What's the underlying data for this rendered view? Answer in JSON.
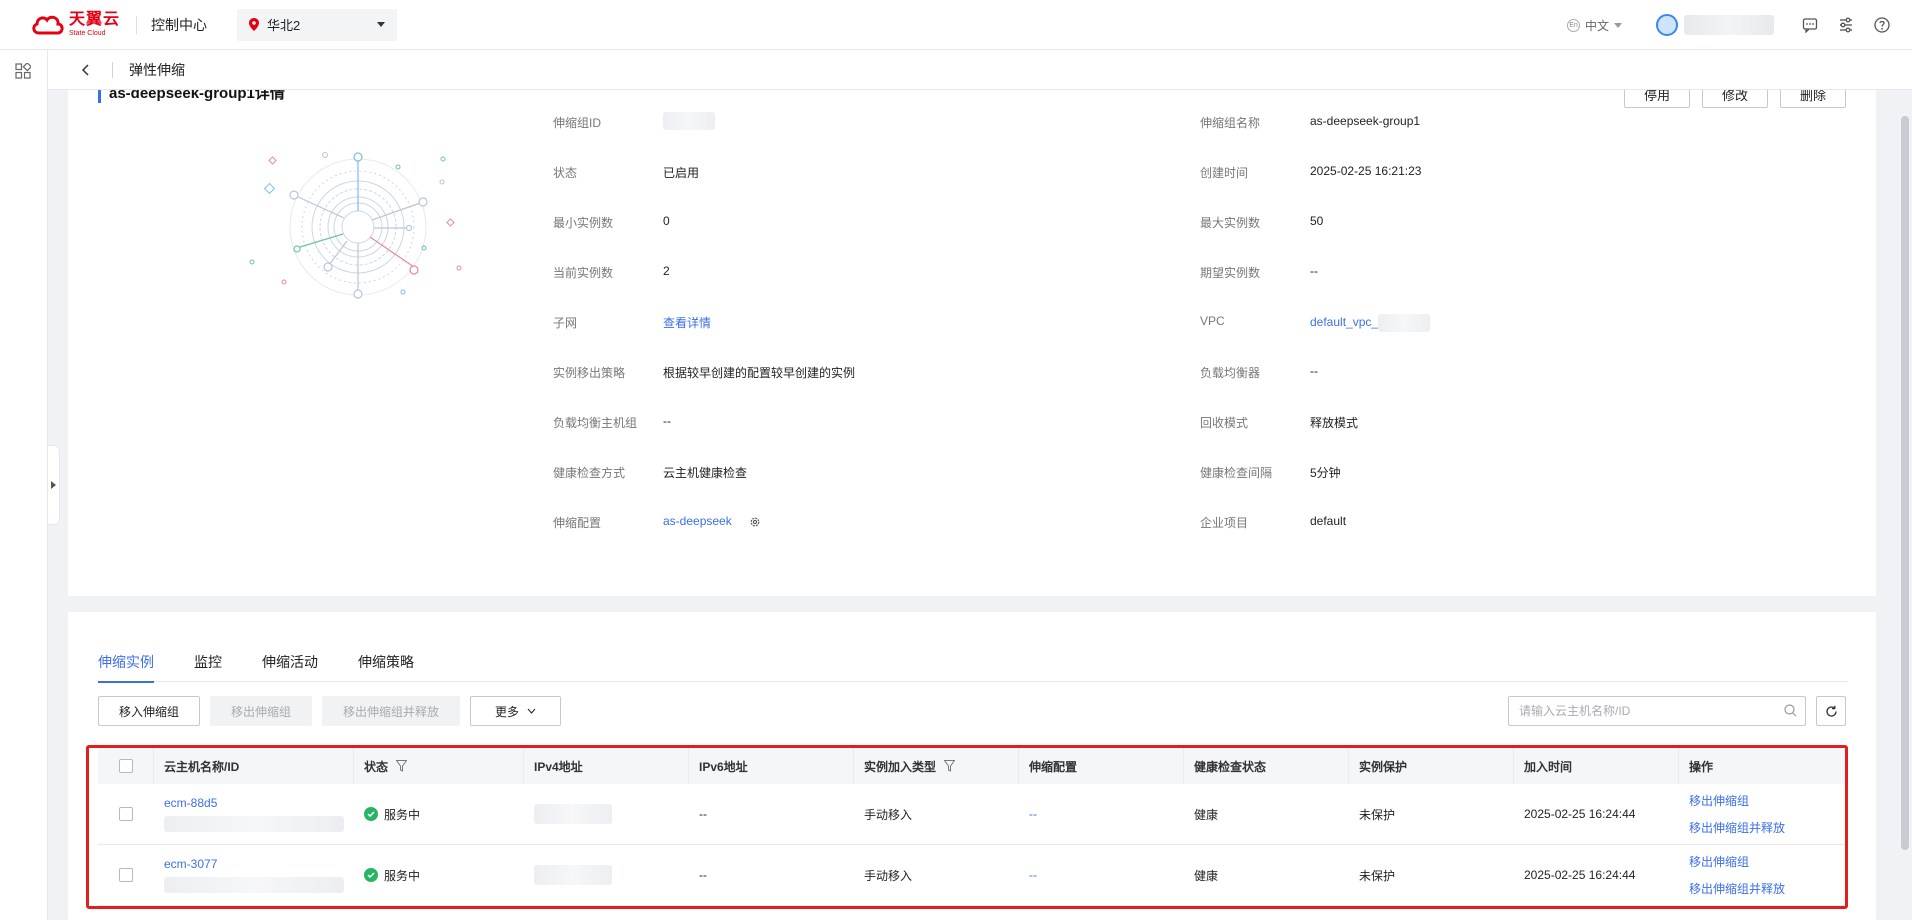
{
  "topbar": {
    "logo_cn": "天翼云",
    "logo_en": "State Cloud",
    "console_title": "控制中心",
    "region": "华北2",
    "language": "中文",
    "lang_badge": "En"
  },
  "breadcrumb": {
    "title": "弹性伸缩"
  },
  "group": {
    "title": "as-deepseek-group1详情",
    "actions": [
      "停用",
      "修改",
      "删除"
    ],
    "fields_left": [
      {
        "label": "伸缩组ID",
        "value": ""
      },
      {
        "label": "状态",
        "value": "已启用"
      },
      {
        "label": "最小实例数",
        "value": "0"
      },
      {
        "label": "当前实例数",
        "value": "2"
      },
      {
        "label": "子网",
        "value": "查看详情"
      },
      {
        "label": "实例移出策略",
        "value": "根据较早创建的配置较早创建的实例"
      },
      {
        "label": "负载均衡主机组",
        "value": "--"
      },
      {
        "label": "健康检查方式",
        "value": "云主机健康检查"
      },
      {
        "label": "伸缩配置",
        "value": "as-deepseek"
      }
    ],
    "fields_right": [
      {
        "label": "伸缩组名称",
        "value": "as-deepseek-group1"
      },
      {
        "label": "创建时间",
        "value": "2025-02-25 16:21:23"
      },
      {
        "label": "最大实例数",
        "value": "50"
      },
      {
        "label": "期望实例数",
        "value": "--"
      },
      {
        "label": "VPC",
        "value": "default_vpc_"
      },
      {
        "label": "负载均衡器",
        "value": "--"
      },
      {
        "label": "回收模式",
        "value": "释放模式"
      },
      {
        "label": "健康检查间隔",
        "value": "5分钟"
      },
      {
        "label": "企业项目",
        "value": "default"
      }
    ]
  },
  "tabs": [
    "伸缩实例",
    "监控",
    "伸缩活动",
    "伸缩策略"
  ],
  "toolbar": {
    "move_in": "移入伸缩组",
    "move_out": "移出伸缩组",
    "move_out_release": "移出伸缩组并释放",
    "more": "更多",
    "search_placeholder": "请输入云主机名称/ID"
  },
  "table": {
    "headers": [
      "云主机名称/ID",
      "状态",
      "IPv4地址",
      "IPv6地址",
      "实例加入类型",
      "伸缩配置",
      "健康检查状态",
      "实例保护",
      "加入时间",
      "操作"
    ],
    "rows": [
      {
        "name": "ecm-88d5",
        "status": "服务中",
        "ipv6": "--",
        "join_type": "手动移入",
        "config": "--",
        "health": "健康",
        "protect": "未保护",
        "time": "2025-02-25 16:24:44",
        "op1": "移出伸缩组",
        "op2": "移出伸缩组并释放"
      },
      {
        "name": "ecm-3077",
        "status": "服务中",
        "ipv6": "--",
        "join_type": "手动移入",
        "config": "--",
        "health": "健康",
        "protect": "未保护",
        "time": "2025-02-25 16:24:44",
        "op1": "移出伸缩组",
        "op2": "移出伸缩组并释放"
      }
    ]
  },
  "colors": {
    "accent": "#3b6fe8",
    "brand": "#e60012",
    "success": "#26b564",
    "highlight": "#e0201f"
  }
}
